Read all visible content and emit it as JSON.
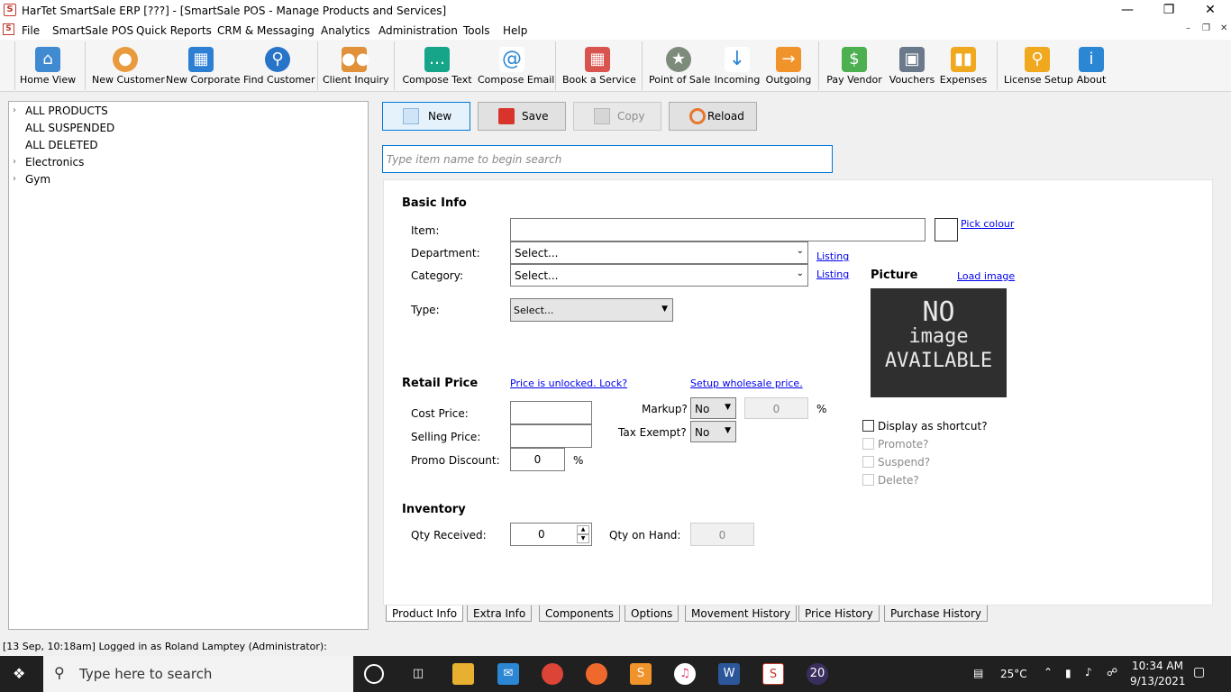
{
  "window": {
    "title": "HarTet SmartSale ERP [???] - [SmartSale POS - Manage Products and Services]",
    "app_icon": "S"
  },
  "menu": [
    "File",
    "SmartSale POS",
    "Quick Reports",
    "CRM & Messaging",
    "Analytics",
    "Administration",
    "Tools",
    "Help"
  ],
  "toolbar": [
    {
      "label": "Home View",
      "icon": "store-icon",
      "color": "#3f8ad1"
    },
    {
      "label": "New Customer",
      "icon": "person-icon",
      "color": "#e89a3c"
    },
    {
      "label": "New Corporate",
      "icon": "building-icon",
      "color": "#2d7fd3"
    },
    {
      "label": "Find Customer",
      "icon": "magnifier-icon",
      "color": "#2874c8"
    },
    {
      "label": "Client Inquiry",
      "icon": "group-icon",
      "color": "#e0913a"
    },
    {
      "label": "Compose Text",
      "icon": "chat-icon",
      "color": "#17a58a"
    },
    {
      "label": "Compose Email",
      "icon": "at-icon",
      "color": "#2b86d4"
    },
    {
      "label": "Book a Service",
      "icon": "calendar-icon",
      "color": "#d9534f"
    },
    {
      "label": "Point of Sale",
      "icon": "cart-icon",
      "color": "#7d8c7a"
    },
    {
      "label": "Incoming",
      "icon": "arrow-down-icon",
      "color": "#2b86d4"
    },
    {
      "label": "Outgoing",
      "icon": "outbox-icon",
      "color": "#f0932b"
    },
    {
      "label": "Pay Vendor",
      "icon": "cash-icon",
      "color": "#4caf50"
    },
    {
      "label": "Vouchers",
      "icon": "briefcase-icon",
      "color": "#6b7a8a"
    },
    {
      "label": "Expenses",
      "icon": "bars-icon",
      "color": "#f0a81e"
    },
    {
      "label": "License Setup",
      "icon": "key-icon",
      "color": "#f0a81e"
    },
    {
      "label": "About",
      "icon": "info-icon",
      "color": "#2b86d4"
    }
  ],
  "tree": {
    "items": [
      "ALL PRODUCTS",
      "ALL SUSPENDED",
      "ALL DELETED",
      "Electronics",
      "Gym"
    ]
  },
  "actions": {
    "new": "New",
    "save": "Save",
    "copy": "Copy",
    "reload": "Reload"
  },
  "search": {
    "placeholder": "Type item name to begin search"
  },
  "basic": {
    "heading": "Basic Info",
    "item_label": "Item:",
    "pick_colour": "Pick colour",
    "department_label": "Department:",
    "department_value": "Select...",
    "listing": "Listing",
    "category_label": "Category:",
    "category_value": "Select...",
    "type_label": "Type:",
    "type_value": "Select..."
  },
  "picture": {
    "heading": "Picture",
    "load": "Load image",
    "placeholder_line1": "NO",
    "placeholder_line2": "image",
    "placeholder_line3": "AVAILABLE"
  },
  "retail": {
    "heading": "Retail Price",
    "unlock_link": "Price is unlocked. Lock?",
    "wholesale_link": "Setup wholesale price.",
    "cost_label": "Cost Price:",
    "selling_label": "Selling Price:",
    "promo_label": "Promo Discount:",
    "promo_value": "0",
    "percent": "%",
    "markup_label": "Markup?",
    "markup_value": "No",
    "markup_amount": "0",
    "tax_label": "Tax Exempt?",
    "tax_value": "No"
  },
  "flags": {
    "shortcut": "Display as shortcut?",
    "promote": "Promote?",
    "suspend": "Suspend?",
    "delete": "Delete?"
  },
  "inventory": {
    "heading": "Inventory",
    "received_label": "Qty Received:",
    "received_value": "0",
    "onhand_label": "Qty on Hand:",
    "onhand_value": "0"
  },
  "tabs": [
    "Product Info",
    "Extra Info",
    "Components",
    "Options",
    "Movement History",
    "Price History",
    "Purchase History"
  ],
  "status": {
    "text": "[13 Sep, 10:18am] Logged in as Roland Lamptey (Administrator):"
  },
  "taskbar": {
    "search": "Type here to search",
    "temp": "25°C",
    "time": "10:34 AM",
    "date": "9/13/2021",
    "badge": "20"
  }
}
